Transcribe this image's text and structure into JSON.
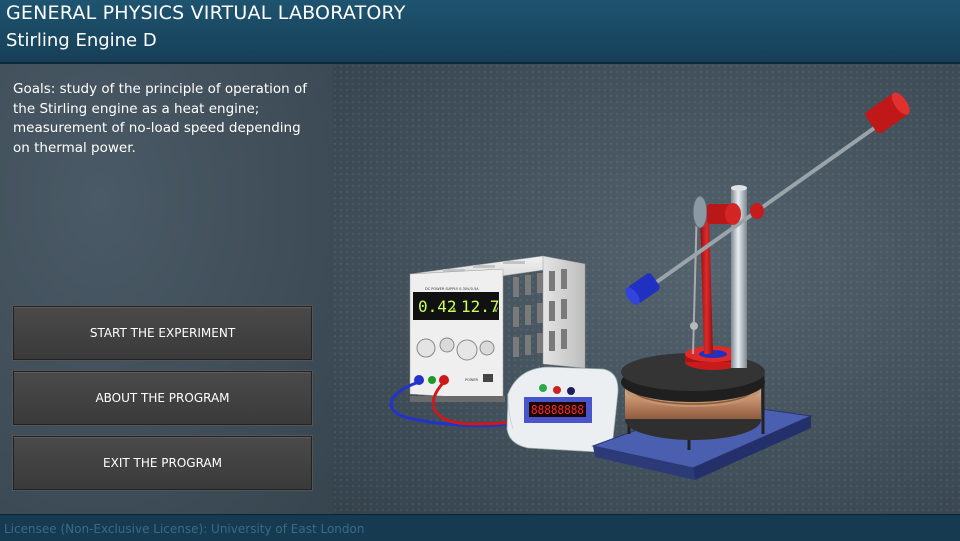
{
  "header": {
    "title": "GENERAL PHYSICS VIRTUAL LABORATORY",
    "subtitle": "Stirling Engine D"
  },
  "goals": {
    "text": "Goals: study of the principle of operation of the Stirling engine as a heat engine; measurement of no-load speed depending on thermal power."
  },
  "menu": {
    "start": "START THE EXPERIMENT",
    "about": "ABOUT THE PROGRAM",
    "exit": "EXIT THE PROGRAM"
  },
  "power_supply": {
    "label": "DC POWER SUPPLY 0-30V/0-5A",
    "voltage_display": "0.42",
    "current_display": "12.7",
    "unit_a": "A",
    "unit_v": "V",
    "power_label": "POWER"
  },
  "speed_meter": {
    "display": "88888888"
  },
  "footer": {
    "license": "Licensee (Non-Exclusive License): University of East London"
  },
  "colors": {
    "header_bg": "#1e5470",
    "footer_bg": "#163a50",
    "button_bg": "#404040",
    "display_green": "#c8ff5a",
    "engine_red": "#c01818",
    "weight_blue": "#2030c0"
  }
}
